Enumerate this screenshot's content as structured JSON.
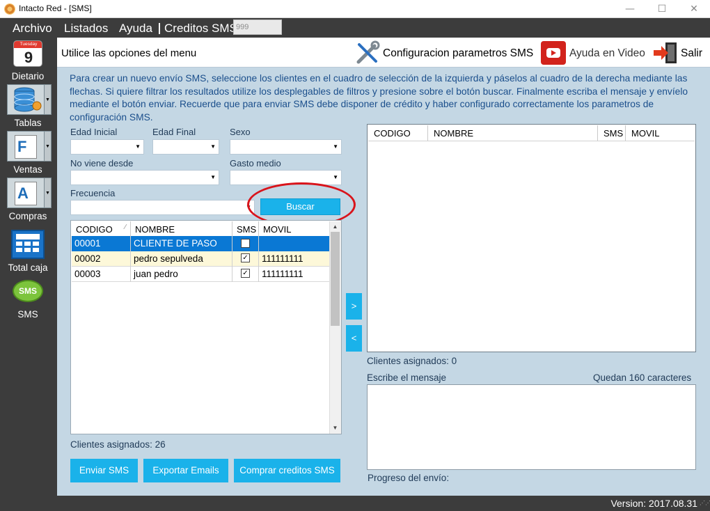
{
  "window": {
    "title": "Intacto Red - [SMS]",
    "minimize": "—",
    "maximize": "☐",
    "close": "✕"
  },
  "menu": {
    "archivo": "Archivo",
    "listados": "Listados",
    "ayuda": "Ayuda",
    "creditos_label": "Creditos SMS",
    "creditos_value": "999"
  },
  "sidebar": {
    "calendar_month": "Tuesday",
    "calendar_day": "9",
    "items": [
      {
        "label": "Dietario"
      },
      {
        "label": "Tablas"
      },
      {
        "label": "Ventas"
      },
      {
        "label": "Compras"
      },
      {
        "label": "Total caja"
      },
      {
        "label": "SMS"
      }
    ],
    "ventas_letter": "F",
    "compras_letter": "A",
    "sms_badge": "SMS"
  },
  "header": {
    "text": "Utilice las opciones del menu",
    "config": "Configuracion parametros SMS",
    "video": "Ayuda en Video",
    "salir": "Salir"
  },
  "instructions": "Para crear un nuevo envío SMS, seleccione los clientes en el cuadro de selección de la izquierda y páselos al cuadro de la derecha mediante las flechas. Si quiere filtrar los resultados utilize los desplegables de filtros y presione sobre el botón buscar. Finalmente escriba el mensaje y envíelo mediante el botón enviar. Recuerde que para enviar SMS debe disponer de crédito y haber configurado correctamente los parametros de configuración SMS.",
  "filters": {
    "edad_inicial": "Edad Inicial",
    "edad_final": "Edad Final",
    "sexo": "Sexo",
    "no_viene": "No viene desde",
    "gasto": "Gasto medio",
    "frecuencia": "Frecuencia",
    "buscar": "Buscar",
    "dropdown_arrow": "▼"
  },
  "left_grid": {
    "columns": {
      "codigo": "CODIGO",
      "nombre": "NOMBRE",
      "sms": "SMS",
      "movil": "MOVIL"
    },
    "rows": [
      {
        "codigo": "00001",
        "nombre": "CLIENTE DE PASO",
        "sms": false,
        "movil": ""
      },
      {
        "codigo": "00002",
        "nombre": "pedro sepulveda",
        "sms": true,
        "movil": "111111111"
      },
      {
        "codigo": "00003",
        "nombre": "juan pedro",
        "sms": true,
        "movil": "111111111"
      }
    ],
    "check_mark": "✓",
    "sort_glyph": "∕",
    "footer": "Clientes asignados: 26"
  },
  "transfer": {
    "right": ">",
    "left": "<"
  },
  "right_grid": {
    "columns": {
      "codigo": "CODIGO",
      "nombre": "NOMBRE",
      "sms": "SMS",
      "movil": "MOVIL"
    },
    "footer": "Clientes asignados: 0"
  },
  "message": {
    "label": "Escribe el mensaje",
    "remaining": "Quedan 160 caracteres",
    "progress": "Progreso del envío:"
  },
  "actions": {
    "enviar": "Enviar SMS",
    "exportar": "Exportar Emails",
    "comprar": "Comprar creditos SMS"
  },
  "status": {
    "version": "Version: 2017.08.31"
  },
  "colors": {
    "accent": "#1ab2ea",
    "selected_row": "#0a78d4",
    "alt_row": "#fdf8d9",
    "panel": "#c4d7e4",
    "highlight_ring": "#d9141b"
  }
}
